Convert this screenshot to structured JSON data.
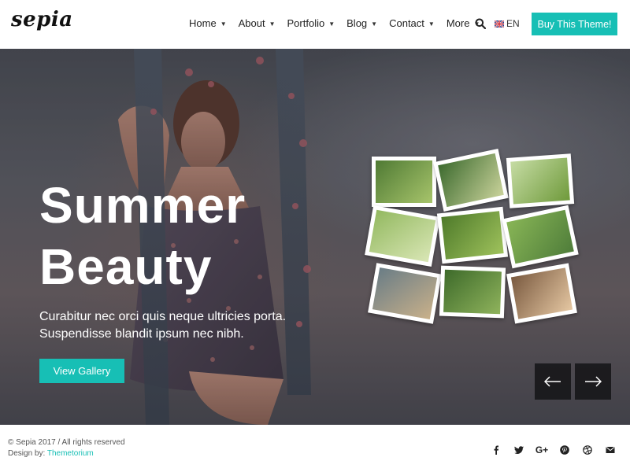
{
  "header": {
    "logo_text": "sepia",
    "nav": [
      {
        "label": "Home",
        "name": "nav-home"
      },
      {
        "label": "About",
        "name": "nav-about"
      },
      {
        "label": "Portfolio",
        "name": "nav-portfolio"
      },
      {
        "label": "Blog",
        "name": "nav-blog"
      },
      {
        "label": "Contact",
        "name": "nav-contact"
      },
      {
        "label": "More",
        "name": "nav-more"
      }
    ],
    "language": "EN",
    "buy_label": "Buy This Theme!"
  },
  "hero": {
    "title_line1": "Summer",
    "title_line2": "Beauty",
    "subtitle_line1": "Curabitur nec orci quis neque ultricies porta.",
    "subtitle_line2": "Suspendisse blandit ipsum nec nibh.",
    "button_label": "View Gallery",
    "prev_icon": "arrow-left-icon",
    "next_icon": "arrow-right-icon"
  },
  "footer": {
    "copyright": "© Sepia 2017 / All rights reserved",
    "credit_prefix": "Design by:",
    "credit_link": "Themetorium",
    "socials": [
      "facebook-icon",
      "twitter-icon",
      "google-plus-icon",
      "pinterest-icon",
      "dribbble-icon",
      "email-icon"
    ]
  },
  "colors": {
    "accent": "#17bfb5",
    "header_bg": "#ffffff",
    "arrow_bg": "#141416"
  }
}
